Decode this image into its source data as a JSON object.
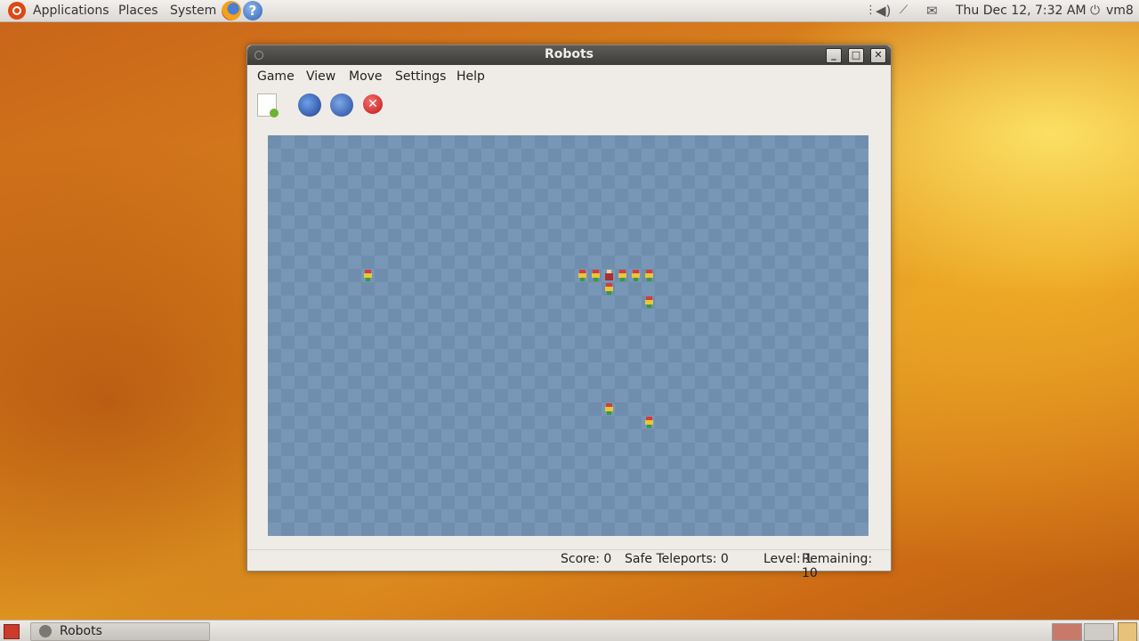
{
  "top_panel": {
    "menus": [
      "Applications",
      "Places",
      "System"
    ],
    "clock": "Thu Dec 12,  7:32 AM",
    "user": "vm8"
  },
  "window": {
    "title": "Robots",
    "menus": [
      "Game",
      "View",
      "Move",
      "Settings",
      "Help"
    ],
    "toolbar": {
      "new_game": "new-game-icon",
      "teleport": "teleport-icon",
      "random_teleport": "random-teleport-icon",
      "wait": "wait-icon"
    },
    "status": {
      "score": "Score: 0",
      "safe_teleports": "Safe Teleports:  0",
      "level": "Level:  1",
      "remaining": "Remaining:  10"
    }
  },
  "taskbar": {
    "tasks": [
      "Robots"
    ]
  },
  "colors": {
    "board": "#6f8eae",
    "titlebar": "#3e3c39",
    "wait_button": "#c51515"
  }
}
